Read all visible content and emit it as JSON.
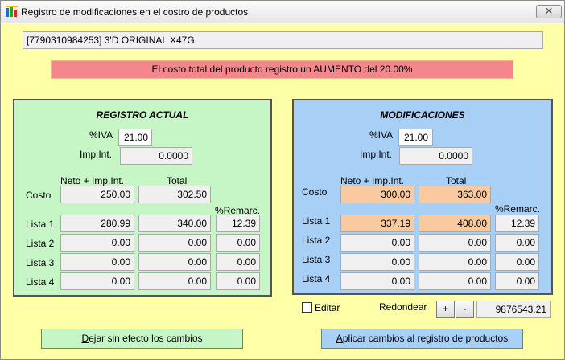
{
  "window": {
    "title": "Registro de modificaciones en el costro de productos",
    "close_glyph": "✕"
  },
  "product": {
    "code_name": "[7790310984253] 3'D ORIGINAL X47G"
  },
  "banner": {
    "text": "El costo total del producto registro un AUMENTO del 20.00%",
    "color": "#f4878c"
  },
  "labels": {
    "iva": "%IVA",
    "imp_int": "Imp.Int.",
    "neto_imp": "Neto + Imp.Int.",
    "total": "Total",
    "remarc": "%Remarc.",
    "costo": "Costo",
    "lista1": "Lista 1",
    "lista2": "Lista 2",
    "lista3": "Lista 3",
    "lista4": "Lista 4"
  },
  "actual": {
    "title": "REGISTRO ACTUAL",
    "iva": "21.00",
    "imp_int": "0.0000",
    "costo": {
      "neto": "250.00",
      "total": "302.50"
    },
    "listas": [
      {
        "neto": "280.99",
        "total": "340.00",
        "remarc": "12.39"
      },
      {
        "neto": "0.00",
        "total": "0.00",
        "remarc": "0.00"
      },
      {
        "neto": "0.00",
        "total": "0.00",
        "remarc": "0.00"
      },
      {
        "neto": "0.00",
        "total": "0.00",
        "remarc": "0.00"
      }
    ]
  },
  "modif": {
    "title": "MODIFICACIONES",
    "iva": "21.00",
    "imp_int": "0.0000",
    "costo": {
      "neto": "300.00",
      "total": "363.00"
    },
    "listas": [
      {
        "neto": "337.19",
        "total": "408.00",
        "remarc": "12.39"
      },
      {
        "neto": "0.00",
        "total": "0.00",
        "remarc": "0.00"
      },
      {
        "neto": "0.00",
        "total": "0.00",
        "remarc": "0.00"
      },
      {
        "neto": "0.00",
        "total": "0.00",
        "remarc": "0.00"
      }
    ]
  },
  "controls": {
    "editar_label": "Editar",
    "editar_checked": false,
    "redondear_label": "Redondear",
    "plus": "+",
    "minus": "-",
    "redondear_value": "9876543.21"
  },
  "buttons": {
    "discard_mnemonic": "D",
    "discard_rest": "ejar sin efecto los cambios",
    "apply_mnemonic": "A",
    "apply_rest": "plicar cambios al registro de productos"
  },
  "colors": {
    "background": "#ffffa8",
    "actual_panel": "#c6f5c6",
    "modif_panel": "#a8cff5",
    "changed_field": "#f9caa0"
  }
}
